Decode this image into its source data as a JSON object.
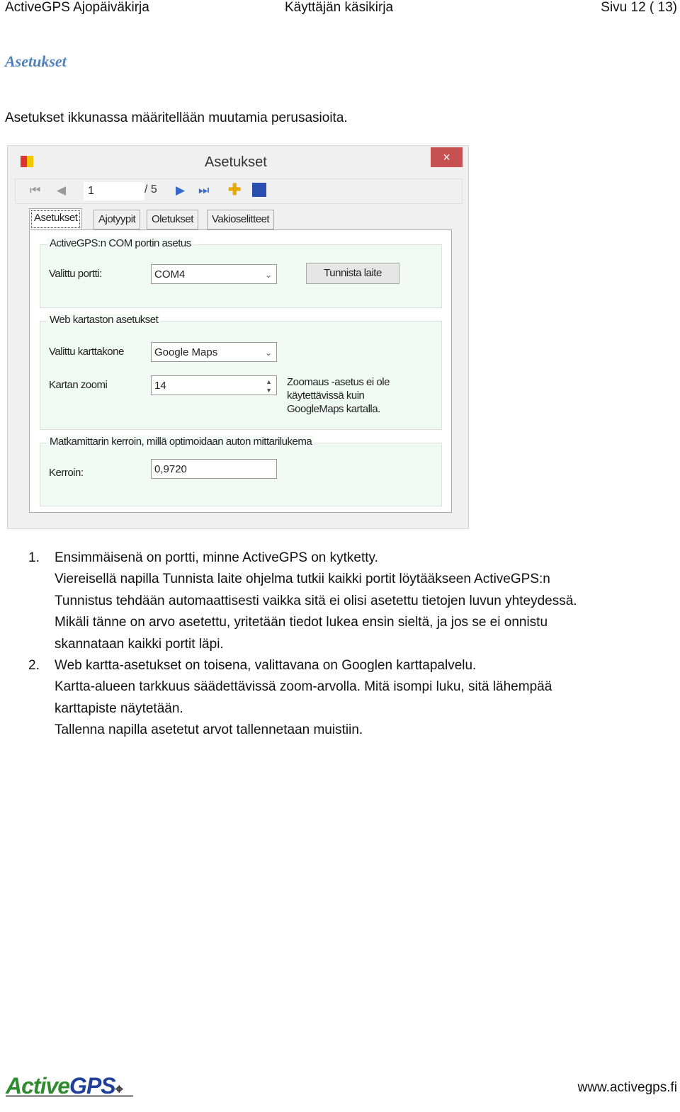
{
  "header": {
    "left": "ActiveGPS Ajopäiväkirja",
    "center": "Käyttäjän käsikirja",
    "right": "Sivu 12 ( 13)"
  },
  "section_title": "Asetukset",
  "intro": "Asetukset ikkunassa määritellään muutamia perusasioita.",
  "window": {
    "title": "Asetukset",
    "close": "×",
    "toolbar": {
      "page": "1",
      "of": "/ 5"
    },
    "tabs": [
      "Asetukset",
      "Ajotyypit",
      "Oletukset",
      "Vakioselitteet"
    ],
    "group_com": {
      "label": "ActiveGPS:n COM portin asetus",
      "port_label": "Valittu portti:",
      "port_value": "COM4",
      "detect_button": "Tunnista laite"
    },
    "group_web": {
      "label": "Web kartaston asetukset",
      "engine_label": "Valittu karttakone",
      "engine_value": "Google Maps",
      "zoom_label": "Kartan zoomi",
      "zoom_value": "14",
      "note": [
        "Zoomaus -asetus ei ole",
        "käytettävissä kuin",
        "GoogleMaps kartalla."
      ]
    },
    "group_factor": {
      "label": "Matkamittarin kerroin, millä optimoidaan auton mittarilukema",
      "factor_label": "Kerroin:",
      "factor_value": "0,9720"
    }
  },
  "list": [
    {
      "num": "1.",
      "lines": [
        "Ensimmäisenä on portti, minne ActiveGPS on kytketty.",
        "Viereisellä napilla Tunnista laite ohjelma tutkii kaikki portit löytääkseen ActiveGPS:n",
        "Tunnistus tehdään automaattisesti vaikka sitä ei olisi asetettu tietojen luvun yhteydessä.",
        "Mikäli tänne on arvo asetettu, yritetään tiedot lukea ensin sieltä, ja jos se ei onnistu",
        "skannataan kaikki portit läpi."
      ]
    },
    {
      "num": "2.",
      "lines": [
        "Web kartta-asetukset on toisena, valittavana on Googlen karttapalvelu.",
        "Kartta-alueen tarkkuus säädettävissä zoom-arvolla. Mitä isompi luku, sitä lähempää",
        "karttapiste näytetään.",
        "Tallenna napilla asetetut arvot tallennetaan muistiin."
      ]
    }
  ],
  "footer": {
    "logo": "ActiveGPS",
    "url": "www.activegps.fi"
  },
  "colors": {
    "heading": "#4f81bd",
    "close": "#c75050",
    "logo_green": "#2e8b2e",
    "logo_blue": "#1f3f99"
  }
}
